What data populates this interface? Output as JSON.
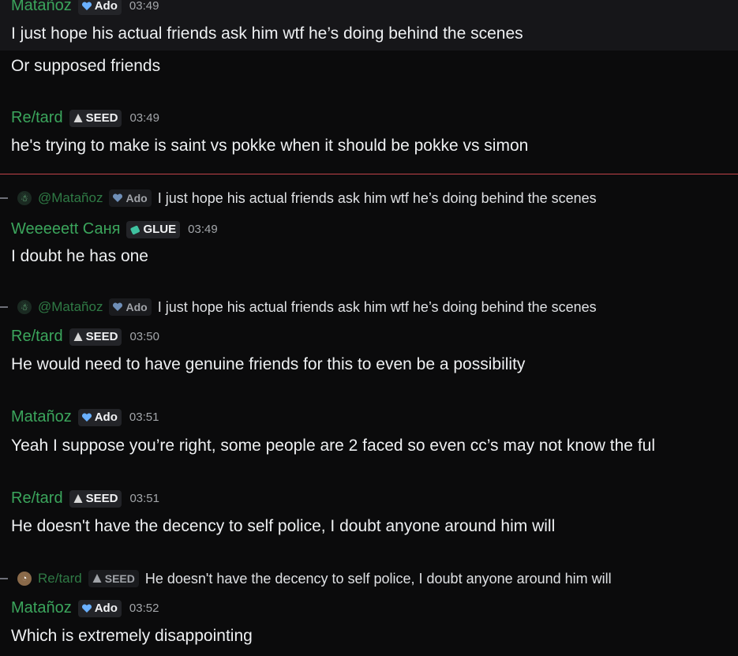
{
  "messages": [
    {
      "author": "Matañoz",
      "badge": "Ado",
      "time": "03:49",
      "lines": [
        "I just hope his actual friends ask him wtf he’s doing behind the scenes",
        "Or supposed friends"
      ]
    },
    {
      "author": "Re/tard",
      "badge": "SEED",
      "time": "03:49",
      "lines": [
        "he's trying to make is saint vs pokke when it should be pokke vs simon"
      ]
    },
    {
      "reply": {
        "author": "@Matañoz",
        "badge": "Ado",
        "text": "I just hope his actual friends ask him wtf he’s doing behind the scenes"
      },
      "author": "Weeeeett Саня",
      "badge": "GLUE",
      "time": "03:49",
      "lines": [
        "I doubt he has one"
      ]
    },
    {
      "reply": {
        "author": "@Matañoz",
        "badge": "Ado",
        "text": "I just hope his actual friends ask him wtf he’s doing behind the scenes"
      },
      "author": "Re/tard",
      "badge": "SEED",
      "time": "03:50",
      "lines": [
        "He would need to have genuine friends for this to even be a possibility"
      ]
    },
    {
      "author": "Matañoz",
      "badge": "Ado",
      "time": "03:51",
      "lines": [
        "Yeah I suppose you’re right, some people are 2 faced so even cc’s may not know the ful"
      ]
    },
    {
      "author": "Re/tard",
      "badge": "SEED",
      "time": "03:51",
      "lines": [
        "He doesn't have the decency to self police, I doubt anyone around him will"
      ]
    },
    {
      "reply": {
        "author": "Re/tard",
        "badge": "SEED",
        "text": "He doesn't have the decency to self police, I doubt anyone around him will"
      },
      "author": "Matañoz",
      "badge": "Ado",
      "time": "03:52",
      "lines": [
        "Which is extremely disappointing"
      ]
    }
  ],
  "colors": {
    "author": "#3ba55c",
    "divider": "#c2424a",
    "background": "#0b0b0c"
  },
  "icons": {
    "ado": "heart-icon",
    "seed": "seed-icon",
    "glue": "glue-icon"
  }
}
